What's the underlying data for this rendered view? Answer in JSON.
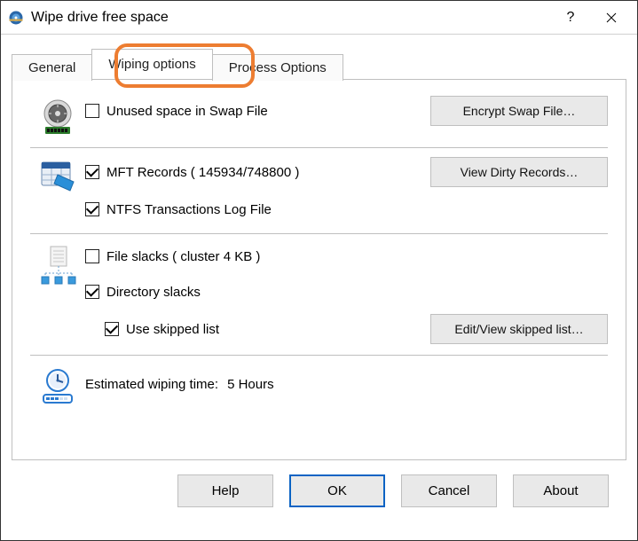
{
  "window": {
    "title": "Wipe drive free space",
    "help_symbol": "?"
  },
  "tabs": {
    "general": "General",
    "wiping": "Wiping options",
    "process": "Process Options"
  },
  "options": {
    "swap": {
      "label": "Unused space in Swap File",
      "button": "Encrypt Swap File…",
      "checked": false
    },
    "mft": {
      "label": "MFT Records ( 145934/748800 )",
      "button": "View Dirty Records…",
      "checked": true
    },
    "ntfs_log": {
      "label": "NTFS Transactions Log File",
      "checked": true
    },
    "file_slacks": {
      "label": "File slacks ( cluster 4 KB )",
      "checked": false
    },
    "dir_slacks": {
      "label": "Directory slacks",
      "checked": true
    },
    "use_skipped": {
      "label": "Use skipped list",
      "button": "Edit/View skipped list…",
      "checked": true
    },
    "estimate_label": "Estimated wiping time:",
    "estimate_value": "5 Hours"
  },
  "buttons": {
    "help": "Help",
    "ok": "OK",
    "cancel": "Cancel",
    "about": "About"
  }
}
